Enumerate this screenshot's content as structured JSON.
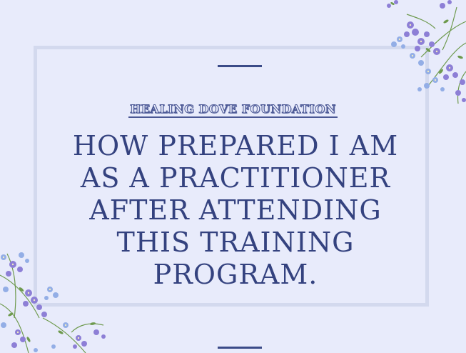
{
  "organization": "HEALING DOVE FOUNDATION",
  "headline_lines": [
    "HOW PREPARED I AM",
    "AS A PRACTITIONER",
    "AFTER ATTENDING",
    "THIS TRAINING",
    "PROGRAM."
  ],
  "colors": {
    "background": "#e8ebfb",
    "frame": "#d3d9ee",
    "text": "#34427f",
    "flower_purple": "#8d7fd6",
    "flower_blue": "#93aee6",
    "leaf_green": "#6e9a4e"
  },
  "decorations": [
    "floral-corner-top-right",
    "floral-corner-bottom-left"
  ]
}
